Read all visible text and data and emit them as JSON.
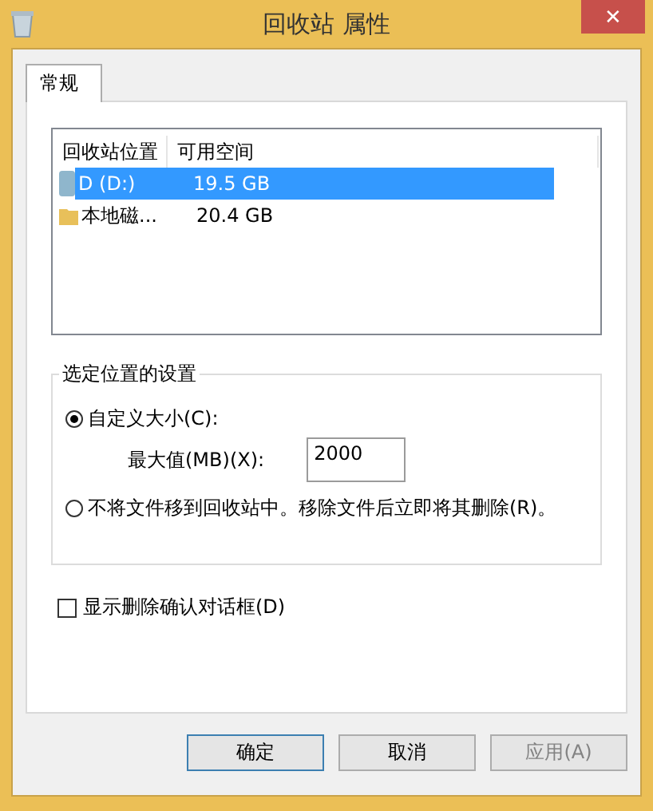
{
  "window": {
    "title": "回收站 属性",
    "close": "✕"
  },
  "tabs": [
    {
      "label": "常规",
      "selected": true
    }
  ],
  "list": {
    "columns": [
      "回收站位置",
      "可用空间"
    ],
    "rows": [
      {
        "location": "D (D:)",
        "space": "19.5 GB",
        "selected": true,
        "kind": "drive"
      },
      {
        "location": "本地磁...",
        "space": "20.4 GB",
        "selected": false,
        "kind": "folder"
      }
    ]
  },
  "group": {
    "title": "选定位置的设置",
    "options": [
      {
        "label": "自定义大小(C):",
        "selected": true
      },
      {
        "label": "不将文件移到回收站中。移除文件后立即将其删除(R)。",
        "selected": false
      }
    ],
    "max_label": "最大值(MB)(X):",
    "max_value": "2000"
  },
  "confirm": {
    "label": "显示删除确认对话框(D)",
    "checked": false
  },
  "buttons": [
    {
      "label": "确定",
      "disabled": false,
      "default": true
    },
    {
      "label": "取消",
      "disabled": false,
      "default": false
    },
    {
      "label": "应用(A)",
      "disabled": true,
      "default": false
    }
  ]
}
